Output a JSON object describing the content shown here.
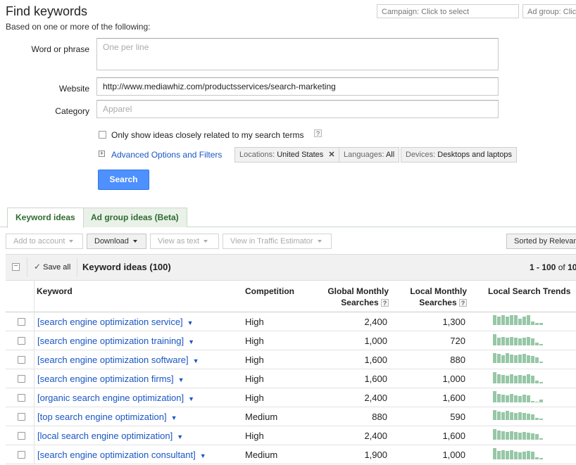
{
  "header": {
    "title": "Find keywords",
    "subtitle": "Based on one or more of the following:",
    "campaign_select": "Campaign: Click to select",
    "adgroup_select": "Ad group: Click"
  },
  "form": {
    "word_label": "Word or phrase",
    "word_placeholder": "One per line",
    "website_label": "Website",
    "website_value": "http://www.mediawhiz.com/productsservices/search-marketing",
    "category_label": "Category",
    "category_placeholder": "Apparel",
    "only_show_label": "Only show ideas closely related to my search terms",
    "advanced_label": "Advanced Options and Filters",
    "chips": {
      "locations_key": "Locations:",
      "locations_val": "United States",
      "languages_key": "Languages:",
      "languages_val": "All",
      "devices_key": "Devices:",
      "devices_val": "Desktops and laptops"
    },
    "search_button": "Search"
  },
  "tabs": [
    {
      "label": "Keyword ideas",
      "active": true
    },
    {
      "label": "Ad group ideas (Beta)",
      "active": false
    }
  ],
  "toolbar": {
    "add_to_account": "Add to account",
    "download": "Download",
    "view_as_text": "View as text",
    "view_in_estimator": "View in Traffic Estimator",
    "sorted_by": "Sorted by Relevan"
  },
  "grid": {
    "save_all": "Save all",
    "title": "Keyword ideas (100)",
    "range_main": "1 - 100",
    "range_of": "of",
    "range_total": "10"
  },
  "columns": {
    "keyword": "Keyword",
    "competition": "Competition",
    "global_l1": "Global Monthly",
    "global_l2": "Searches",
    "local_l1": "Local Monthly",
    "local_l2": "Searches",
    "trends": "Local Search Trends"
  },
  "rows": [
    {
      "keyword": "[search engine optimization service]",
      "competition": "High",
      "global": "2,400",
      "local": "1,300",
      "trend": [
        0.8,
        0.65,
        0.8,
        0.65,
        0.8,
        0.75,
        0.5,
        0.65,
        0.8,
        0.25,
        0.15,
        0.15
      ]
    },
    {
      "keyword": "[search engine optimization training]",
      "competition": "High",
      "global": "1,000",
      "local": "720",
      "trend": [
        0.9,
        0.6,
        0.65,
        0.6,
        0.65,
        0.6,
        0.55,
        0.6,
        0.65,
        0.55,
        0.2,
        0.1
      ]
    },
    {
      "keyword": "[search engine optimization software]",
      "competition": "High",
      "global": "1,600",
      "local": "880",
      "trend": [
        0.8,
        0.7,
        0.6,
        0.75,
        0.65,
        0.6,
        0.65,
        0.7,
        0.6,
        0.55,
        0.45,
        0.1
      ]
    },
    {
      "keyword": "[search engine optimization firms]",
      "competition": "High",
      "global": "1,600",
      "local": "1,000",
      "trend": [
        0.9,
        0.7,
        0.65,
        0.6,
        0.7,
        0.6,
        0.65,
        0.6,
        0.7,
        0.6,
        0.2,
        0.1
      ]
    },
    {
      "keyword": "[organic search engine optimization]",
      "competition": "High",
      "global": "2,400",
      "local": "1,600",
      "trend": [
        0.9,
        0.65,
        0.6,
        0.55,
        0.65,
        0.55,
        0.5,
        0.6,
        0.55,
        0.1,
        0,
        0.2
      ]
    },
    {
      "keyword": "[top search engine optimization]",
      "competition": "Medium",
      "global": "880",
      "local": "590",
      "trend": [
        0.8,
        0.65,
        0.6,
        0.7,
        0.6,
        0.55,
        0.6,
        0.55,
        0.5,
        0.45,
        0.15,
        0.1
      ]
    },
    {
      "keyword": "[local search engine optimization]",
      "competition": "High",
      "global": "2,400",
      "local": "1,600",
      "trend": [
        0.85,
        0.7,
        0.65,
        0.6,
        0.65,
        0.6,
        0.55,
        0.6,
        0.55,
        0.5,
        0.45,
        0.1
      ]
    },
    {
      "keyword": "[search engine optimization consultant]",
      "competition": "Medium",
      "global": "1,900",
      "local": "1,000",
      "trend": [
        0.9,
        0.65,
        0.7,
        0.65,
        0.7,
        0.6,
        0.55,
        0.6,
        0.65,
        0.6,
        0.15,
        0.1
      ]
    }
  ],
  "colors": {
    "accent": "#4d90fe",
    "link": "#1a56c4",
    "tab_text": "#2f6b2f",
    "trend_bar": "#97c7a7"
  }
}
